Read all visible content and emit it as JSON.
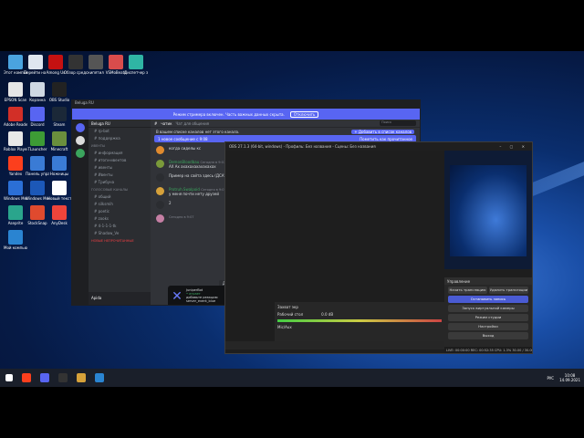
{
  "desktop_icons": [
    {
      "label": "Этот компьютер",
      "color": "#4aa3df"
    },
    {
      "label": "Перейти на Windows",
      "color": "#dfe6ef"
    },
    {
      "label": "Among Us",
      "color": "#c51111"
    },
    {
      "label": "Обзор средств",
      "color": "#333333"
    },
    {
      "label": "кипятил",
      "color": "#555555"
    },
    {
      "label": "VSMoBeats",
      "color": "#d94c4c"
    },
    {
      "label": "Диспетчер задач",
      "color": "#2fb5a4"
    },
    {
      "label": "EPSON Scan",
      "color": "#e6e6e6"
    },
    {
      "label": "Корзина",
      "color": "#cfd8e3"
    },
    {
      "label": "OBS Studio",
      "color": "#222222"
    },
    {
      "label": "Adobe Reader",
      "color": "#d22f27"
    },
    {
      "label": "Discord",
      "color": "#5865f2"
    },
    {
      "label": "Steam",
      "color": "#1b2838"
    },
    {
      "label": "Roblox Player",
      "color": "#e8e8e8"
    },
    {
      "label": "TLauncher",
      "color": "#3d9b35"
    },
    {
      "label": "Minecraft",
      "color": "#6a8f3d"
    },
    {
      "label": "Yandex",
      "color": "#fc3f1d"
    },
    {
      "label": "Панель управления",
      "color": "#3a7bd5"
    },
    {
      "label": "Ножницы",
      "color": "#3a7bd5"
    },
    {
      "label": "Windows Media Player",
      "color": "#2b6fd6"
    },
    {
      "label": "Windows Media",
      "color": "#1c58b8"
    },
    {
      "label": "Новый текстовый документ",
      "color": "#ffffff"
    },
    {
      "label": "Aseprite",
      "color": "#2aa58c"
    },
    {
      "label": "StockSnap",
      "color": "#e04a2e"
    },
    {
      "label": "AnyDesk",
      "color": "#ef443b"
    },
    {
      "label": "Мой компьютер",
      "color": "#2a84d1"
    }
  ],
  "discord": {
    "banner_text": "Режим стримера включен. Часть важных данных скрыта.",
    "banner_button": "Отключить",
    "server_name": "Beluga RU",
    "channel_title": "чатик",
    "channel_topic": "Чат для общения",
    "search_placeholder": "Поиск",
    "info_text": "В вашем списке каналов нет этого канала.",
    "info_button": "+ Добавить в список каналов",
    "new_messages": "1 новое сообщение с 9:08",
    "new_messages_right": "Пометить как прочитанное",
    "channels": [
      {
        "type": "item",
        "label": "rp-bot"
      },
      {
        "type": "item",
        "label": "поддержка"
      },
      {
        "type": "cat",
        "label": "ИВЕНТЫ"
      },
      {
        "type": "item",
        "label": "информация"
      },
      {
        "type": "item",
        "label": "итоги-ивентов"
      },
      {
        "type": "item",
        "label": "ивенты"
      },
      {
        "type": "item",
        "label": "Ивенты"
      },
      {
        "type": "item",
        "label": "Трибуна"
      },
      {
        "type": "cat",
        "label": "ГОЛОСОВЫЕ КАНАЛЫ"
      },
      {
        "type": "item",
        "label": "общий"
      },
      {
        "type": "item",
        "label": "silksmih"
      },
      {
        "type": "item",
        "label": "poetic"
      },
      {
        "type": "item",
        "label": "zooks"
      },
      {
        "type": "item",
        "label": "4-1-1-1-tk"
      },
      {
        "type": "item",
        "label": "Shadow_Ve"
      }
    ],
    "new_unread": "НОВЫЕ НЕПРОЧИТАННЫЕ",
    "user_name": "Apida",
    "messages": [
      {
        "name": "",
        "time": "",
        "text": "когда сиделы кс",
        "avatar": "#e08a2e"
      },
      {
        "name": "DemonBloodbau",
        "time": "Сегодня в 9:07",
        "text": "АХ Ах ахахахахахахахах",
        "avatar": "#7a9a3a"
      },
      {
        "name": "",
        "time": "",
        "text": "Пример на сайта здесь (ДСАЧ) | Свободный код может меня в игру",
        "avatar": "#2b2d31"
      },
      {
        "name": "Protruh.Swalpoid",
        "time": "Сегодня в 9:07",
        "text": "у меня почти нету друзей",
        "avatar": "#d6a13a"
      },
      {
        "name": "",
        "time": "",
        "text": "2",
        "avatar": "#2b2d31"
      },
      {
        "name": "",
        "time": "Сегодня в 9:07",
        "text": "",
        "avatar": "#c57fa4"
      }
    ],
    "popup": {
      "title": "JuniperBot",
      "status": "• играет",
      "line1": "добавьте реакцию",
      "line2": "server_event_blue"
    },
    "thread_label": "Далее: Ознакомиться с информацией о сервере",
    "input_placeholder": "Написать #чатик",
    "mode_note": "Модерация режимом"
  },
  "obs": {
    "title": "OBS 27.1.3 (64-bit, windows) - Профиль: Без названия - Сцены: Без названия",
    "controls_header": "Управление",
    "buttons": [
      "Начать трансляцию",
      "Остановить запись",
      "Запуск виртуальной камеры",
      "Режим студии",
      "Настройки",
      "Выход"
    ],
    "top_buttons": [
      "Начать трансляцию",
      "Удалить трансляции"
    ],
    "mixer": {
      "source": "Захват экр",
      "desktop_audio": "Рабочий стол",
      "desktop_level": "0.0 dB",
      "mic_label": "Mic/Aux"
    },
    "status_bar": "LIVE: 00:00:00   REC: 00:52:35   CPU: 1.3%   30.00 / 30.00 FPS"
  },
  "taskbar": {
    "time": "10:08",
    "date": "14.09.2021",
    "lang": "РУС"
  }
}
